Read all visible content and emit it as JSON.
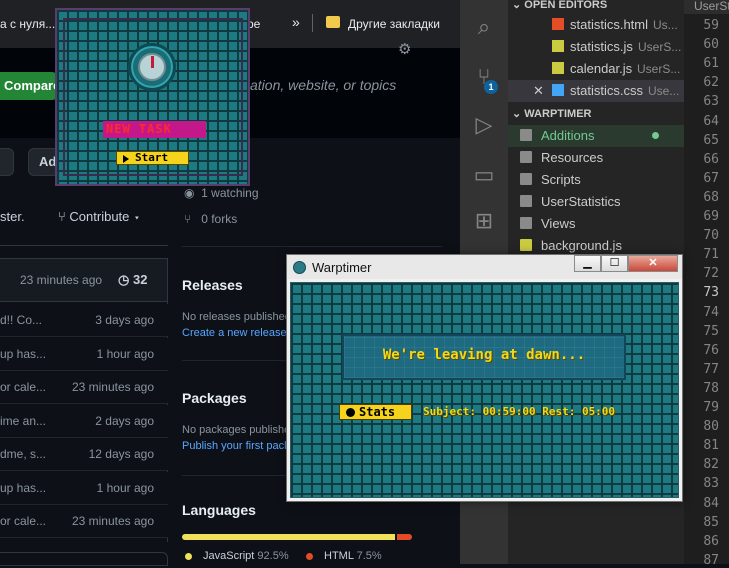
{
  "browser": {
    "bookmarks": {
      "tab_fragment": "а с нуля...",
      "fragment2": "ре",
      "more_chevron": "»",
      "other_bookmarks": "Другие закладки"
    },
    "github": {
      "compare_label": "Compare",
      "search_placeholder": "ation, website, or topics",
      "chip2_label": "Ad",
      "master_text": "ster.",
      "contribute_label": "Contribute",
      "commit_time": "23 minutes ago",
      "commit_count": "32",
      "files": [
        {
          "msg": "d!! Co...",
          "time": "3 days ago"
        },
        {
          "msg": "up has...",
          "time": "1 hour ago"
        },
        {
          "msg": "or cale...",
          "time": "23 minutes ago"
        },
        {
          "msg": "ime an...",
          "time": "2 days ago"
        },
        {
          "msg": "dme, s...",
          "time": "12 days ago"
        },
        {
          "msg": "up has...",
          "time": "1 hour ago"
        },
        {
          "msg": "or cale...",
          "time": "23 minutes ago"
        }
      ],
      "watching": "1 watching",
      "forks": "0 forks",
      "releases": {
        "heading": "Releases",
        "text": "No releases published",
        "link": "Create a new release"
      },
      "packages": {
        "heading": "Packages",
        "text": "No packages publishe",
        "link": "Publish your first packa"
      },
      "languages": {
        "heading": "Languages",
        "items": [
          {
            "name": "JavaScript",
            "pct": "92.5%",
            "value": 92.5,
            "color": "#f1e05a"
          },
          {
            "name": "HTML",
            "pct": "7.5%",
            "value": 7.5,
            "color": "#e34c26"
          }
        ]
      }
    }
  },
  "vscode": {
    "tab_fragment": "UserSt",
    "open_editors_label": "OPEN EDITORS",
    "open_editors": [
      {
        "name": "statistics.html",
        "desc": "Us...",
        "icon_color": "#e44d26",
        "icon": "html-file-icon"
      },
      {
        "name": "statistics.js",
        "desc": "UserS...",
        "icon_color": "#cbcb41",
        "icon": "js-file-icon"
      },
      {
        "name": "calendar.js",
        "desc": "UserS...",
        "icon_color": "#cbcb41",
        "icon": "js-file-icon"
      },
      {
        "name": "statistics.css",
        "desc": "Use...",
        "icon_color": "#42a5f5",
        "icon": "css-file-icon"
      }
    ],
    "close_glyph": "✕",
    "workspace_label": "WARPTIMER",
    "folders": [
      {
        "name": "Additions",
        "color": "#73c991"
      },
      {
        "name": "Resources",
        "color": "#cccccc"
      },
      {
        "name": "Scripts",
        "color": "#cccccc"
      },
      {
        "name": "UserStatistics",
        "color": "#cccccc"
      },
      {
        "name": "Views",
        "color": "#cccccc"
      },
      {
        "name": "background.js",
        "color": "#cccccc"
      }
    ],
    "line_numbers": [
      "59",
      "60",
      "61",
      "62",
      "63",
      "64",
      "65",
      "66",
      "67",
      "68",
      "69",
      "70",
      "71",
      "72",
      "73",
      "74",
      "75",
      "76",
      "77",
      "78",
      "79",
      "80",
      "81",
      "82",
      "83",
      "84",
      "85",
      "86",
      "87"
    ],
    "current_line": "73",
    "source_control_badge": "1"
  },
  "widget": {
    "task_label": "NEW TASK",
    "start_label": "Start"
  },
  "warptimer": {
    "title": "Warptimer",
    "minimize": "▁",
    "maximize": "☐",
    "close": "✕",
    "banner": "We're leaving at dawn...",
    "stats_label": "Stats",
    "subject_line": "Subject: 00:59:00 Rest: 05:00"
  },
  "colors": {
    "github_bg": "#0d1117",
    "vscode_sidebar": "#252526",
    "brick": "#1d7a82",
    "accent_yellow": "#f5d31c",
    "task_pink": "#c2188a"
  }
}
